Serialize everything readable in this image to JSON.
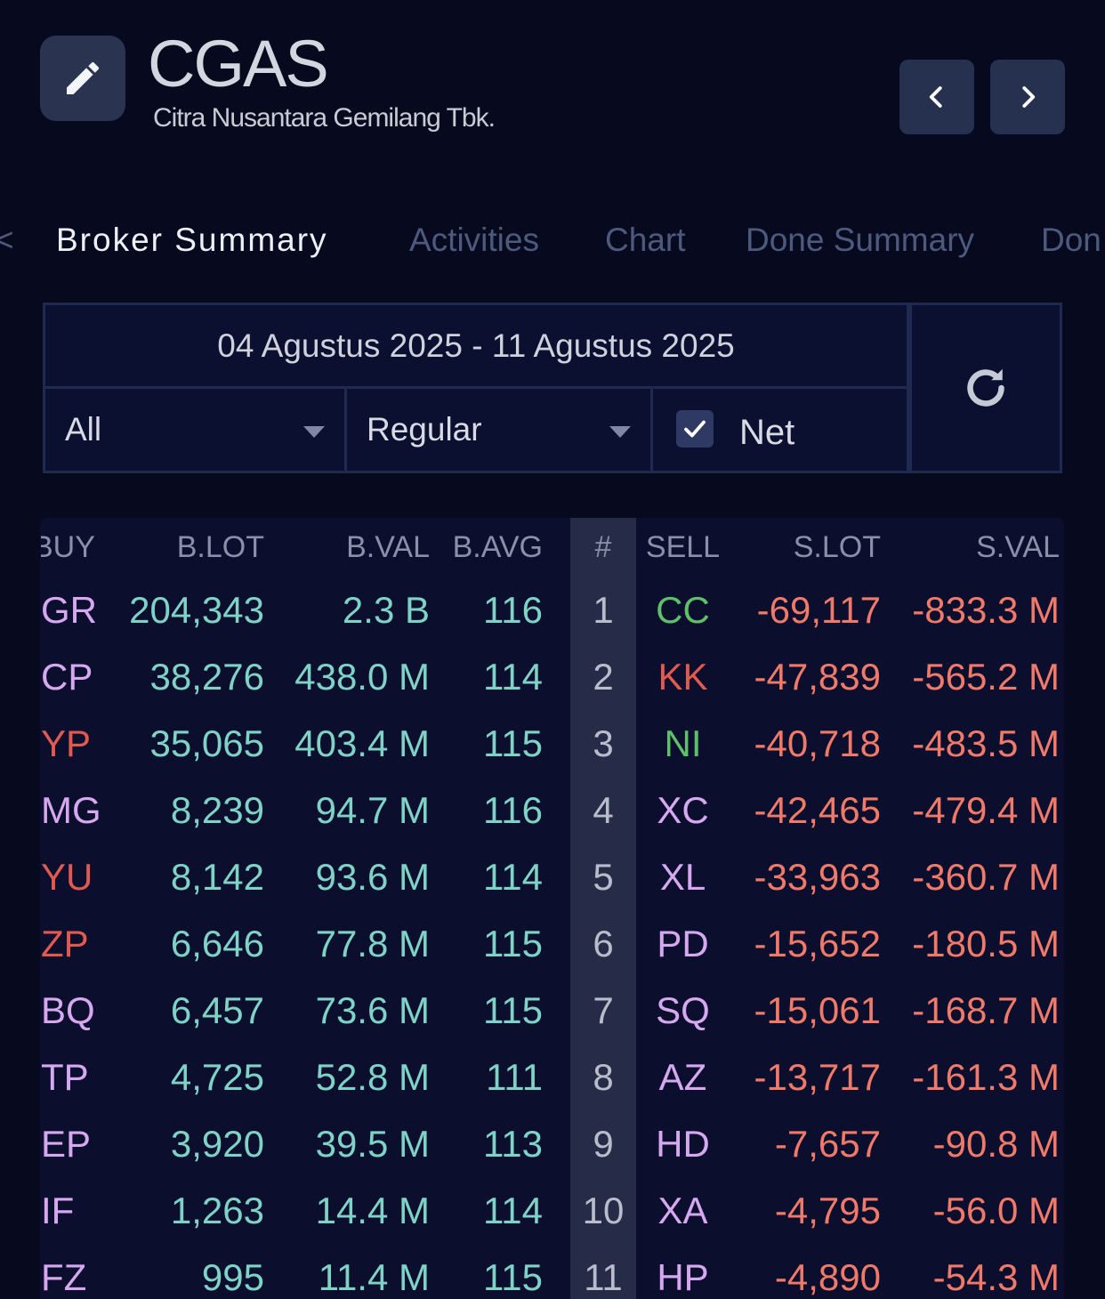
{
  "header": {
    "ticker": "CGAS",
    "company_name": "Citra Nusantara Gemilang Tbk."
  },
  "tabs": [
    {
      "label": "Broker Summary",
      "active": true
    },
    {
      "label": "Activities",
      "active": false
    },
    {
      "label": "Chart",
      "active": false
    },
    {
      "label": "Done Summary",
      "active": false
    },
    {
      "label": "Don",
      "active": false
    }
  ],
  "filters": {
    "date_range": "04 Agustus 2025 - 11 Agustus 2025",
    "investor_type": "All",
    "market_type": "Regular",
    "net_label": "Net",
    "net_checked": true
  },
  "table": {
    "columns": {
      "buy": "BUY",
      "b_lot": "B.LOT",
      "b_val": "B.VAL",
      "b_avg": "B.AVG",
      "rank": "#",
      "sell": "SELL",
      "s_lot": "S.LOT",
      "s_val": "S.VAL"
    },
    "rows": [
      {
        "buy": "GR",
        "buy_color": "#d6a8f0",
        "b_lot": "204,343",
        "b_val": "2.3 B",
        "b_avg": "116",
        "rank": "1",
        "sell": "CC",
        "sell_color": "#5fbf6a",
        "s_lot": "-69,117",
        "s_val": "-833.3 M"
      },
      {
        "buy": "CP",
        "buy_color": "#d6a8f0",
        "b_lot": "38,276",
        "b_val": "438.0 M",
        "b_avg": "114",
        "rank": "2",
        "sell": "KK",
        "sell_color": "#e05a50",
        "s_lot": "-47,839",
        "s_val": "-565.2 M"
      },
      {
        "buy": "YP",
        "buy_color": "#e05a50",
        "b_lot": "35,065",
        "b_val": "403.4 M",
        "b_avg": "115",
        "rank": "3",
        "sell": "NI",
        "sell_color": "#5fbf6a",
        "s_lot": "-40,718",
        "s_val": "-483.5 M"
      },
      {
        "buy": "MG",
        "buy_color": "#d6a8f0",
        "b_lot": "8,239",
        "b_val": "94.7 M",
        "b_avg": "116",
        "rank": "4",
        "sell": "XC",
        "sell_color": "#d6a8f0",
        "s_lot": "-42,465",
        "s_val": "-479.4 M"
      },
      {
        "buy": "YU",
        "buy_color": "#e05a50",
        "b_lot": "8,142",
        "b_val": "93.6 M",
        "b_avg": "114",
        "rank": "5",
        "sell": "XL",
        "sell_color": "#d6a8f0",
        "s_lot": "-33,963",
        "s_val": "-360.7 M"
      },
      {
        "buy": "ZP",
        "buy_color": "#e05a50",
        "b_lot": "6,646",
        "b_val": "77.8 M",
        "b_avg": "115",
        "rank": "6",
        "sell": "PD",
        "sell_color": "#d6a8f0",
        "s_lot": "-15,652",
        "s_val": "-180.5 M"
      },
      {
        "buy": "BQ",
        "buy_color": "#d6a8f0",
        "b_lot": "6,457",
        "b_val": "73.6 M",
        "b_avg": "115",
        "rank": "7",
        "sell": "SQ",
        "sell_color": "#d6a8f0",
        "s_lot": "-15,061",
        "s_val": "-168.7 M"
      },
      {
        "buy": "TP",
        "buy_color": "#d6a8f0",
        "b_lot": "4,725",
        "b_val": "52.8 M",
        "b_avg": "111",
        "rank": "8",
        "sell": "AZ",
        "sell_color": "#d6a8f0",
        "s_lot": "-13,717",
        "s_val": "-161.3 M"
      },
      {
        "buy": "EP",
        "buy_color": "#d6a8f0",
        "b_lot": "3,920",
        "b_val": "39.5 M",
        "b_avg": "113",
        "rank": "9",
        "sell": "HD",
        "sell_color": "#d6a8f0",
        "s_lot": "-7,657",
        "s_val": "-90.8 M"
      },
      {
        "buy": "IF",
        "buy_color": "#d6a8f0",
        "b_lot": "1,263",
        "b_val": "14.4 M",
        "b_avg": "114",
        "rank": "10",
        "sell": "XA",
        "sell_color": "#d6a8f0",
        "s_lot": "-4,795",
        "s_val": "-56.0 M"
      },
      {
        "buy": "FZ",
        "buy_color": "#d6a8f0",
        "b_lot": "995",
        "b_val": "11.4 M",
        "b_avg": "115",
        "rank": "11",
        "sell": "HP",
        "sell_color": "#d6a8f0",
        "s_lot": "-4,890",
        "s_val": "-54.3 M"
      }
    ]
  },
  "colors": {
    "background": "#070a1f",
    "buy_value": "#7fd3c6",
    "sell_value": "#f07a6a",
    "foreign_broker": "#d6a8f0",
    "domestic_broker": "#e05a50",
    "government_broker": "#5fbf6a"
  },
  "icons": {
    "edit": "pencil-icon",
    "prev": "chevron-left-icon",
    "next": "chevron-right-icon",
    "refresh": "refresh-icon",
    "dropdown": "caret-down-icon",
    "check": "check-icon"
  }
}
